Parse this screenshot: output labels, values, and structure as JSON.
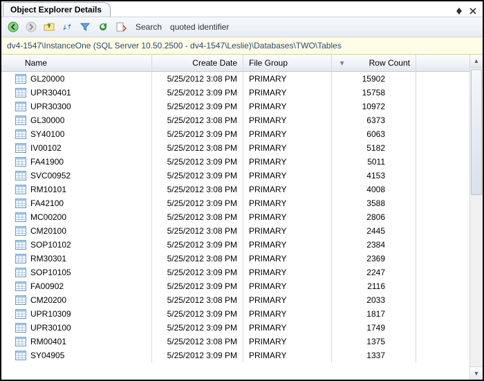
{
  "title": "Object Explorer Details",
  "toolbar": {
    "search_label": "Search",
    "search_value": "quoted identifier"
  },
  "breadcrumb": "dv4-1547\\InstanceOne (SQL Server 10.50.2500 - dv4-1547\\Leslie)\\Databases\\TWO\\Tables",
  "columns": [
    "Name",
    "Create Date",
    "File Group",
    "Row Count"
  ],
  "rows": [
    {
      "name": "GL20000",
      "create": "5/25/2012 3:08 PM",
      "fg": "PRIMARY",
      "rc": "15902"
    },
    {
      "name": "UPR30401",
      "create": "5/25/2012 3:09 PM",
      "fg": "PRIMARY",
      "rc": "15758"
    },
    {
      "name": "UPR30300",
      "create": "5/25/2012 3:09 PM",
      "fg": "PRIMARY",
      "rc": "10972"
    },
    {
      "name": "GL30000",
      "create": "5/25/2012 3:08 PM",
      "fg": "PRIMARY",
      "rc": "6373"
    },
    {
      "name": "SY40100",
      "create": "5/25/2012 3:09 PM",
      "fg": "PRIMARY",
      "rc": "6063"
    },
    {
      "name": "IV00102",
      "create": "5/25/2012 3:08 PM",
      "fg": "PRIMARY",
      "rc": "5182"
    },
    {
      "name": "FA41900",
      "create": "5/25/2012 3:09 PM",
      "fg": "PRIMARY",
      "rc": "5011"
    },
    {
      "name": "SVC00952",
      "create": "5/25/2012 3:09 PM",
      "fg": "PRIMARY",
      "rc": "4153"
    },
    {
      "name": "RM10101",
      "create": "5/25/2012 3:08 PM",
      "fg": "PRIMARY",
      "rc": "4008"
    },
    {
      "name": "FA42100",
      "create": "5/25/2012 3:09 PM",
      "fg": "PRIMARY",
      "rc": "3588"
    },
    {
      "name": "MC00200",
      "create": "5/25/2012 3:08 PM",
      "fg": "PRIMARY",
      "rc": "2806"
    },
    {
      "name": "CM20100",
      "create": "5/25/2012 3:08 PM",
      "fg": "PRIMARY",
      "rc": "2445"
    },
    {
      "name": "SOP10102",
      "create": "5/25/2012 3:09 PM",
      "fg": "PRIMARY",
      "rc": "2384"
    },
    {
      "name": "RM30301",
      "create": "5/25/2012 3:08 PM",
      "fg": "PRIMARY",
      "rc": "2369"
    },
    {
      "name": "SOP10105",
      "create": "5/25/2012 3:09 PM",
      "fg": "PRIMARY",
      "rc": "2247"
    },
    {
      "name": "FA00902",
      "create": "5/25/2012 3:09 PM",
      "fg": "PRIMARY",
      "rc": "2116"
    },
    {
      "name": "CM20200",
      "create": "5/25/2012 3:08 PM",
      "fg": "PRIMARY",
      "rc": "2033"
    },
    {
      "name": "UPR10309",
      "create": "5/25/2012 3:09 PM",
      "fg": "PRIMARY",
      "rc": "1817"
    },
    {
      "name": "UPR30100",
      "create": "5/25/2012 3:09 PM",
      "fg": "PRIMARY",
      "rc": "1749"
    },
    {
      "name": "RM00401",
      "create": "5/25/2012 3:08 PM",
      "fg": "PRIMARY",
      "rc": "1375"
    },
    {
      "name": "SY04905",
      "create": "5/25/2012 3:09 PM",
      "fg": "PRIMARY",
      "rc": "1337"
    }
  ]
}
